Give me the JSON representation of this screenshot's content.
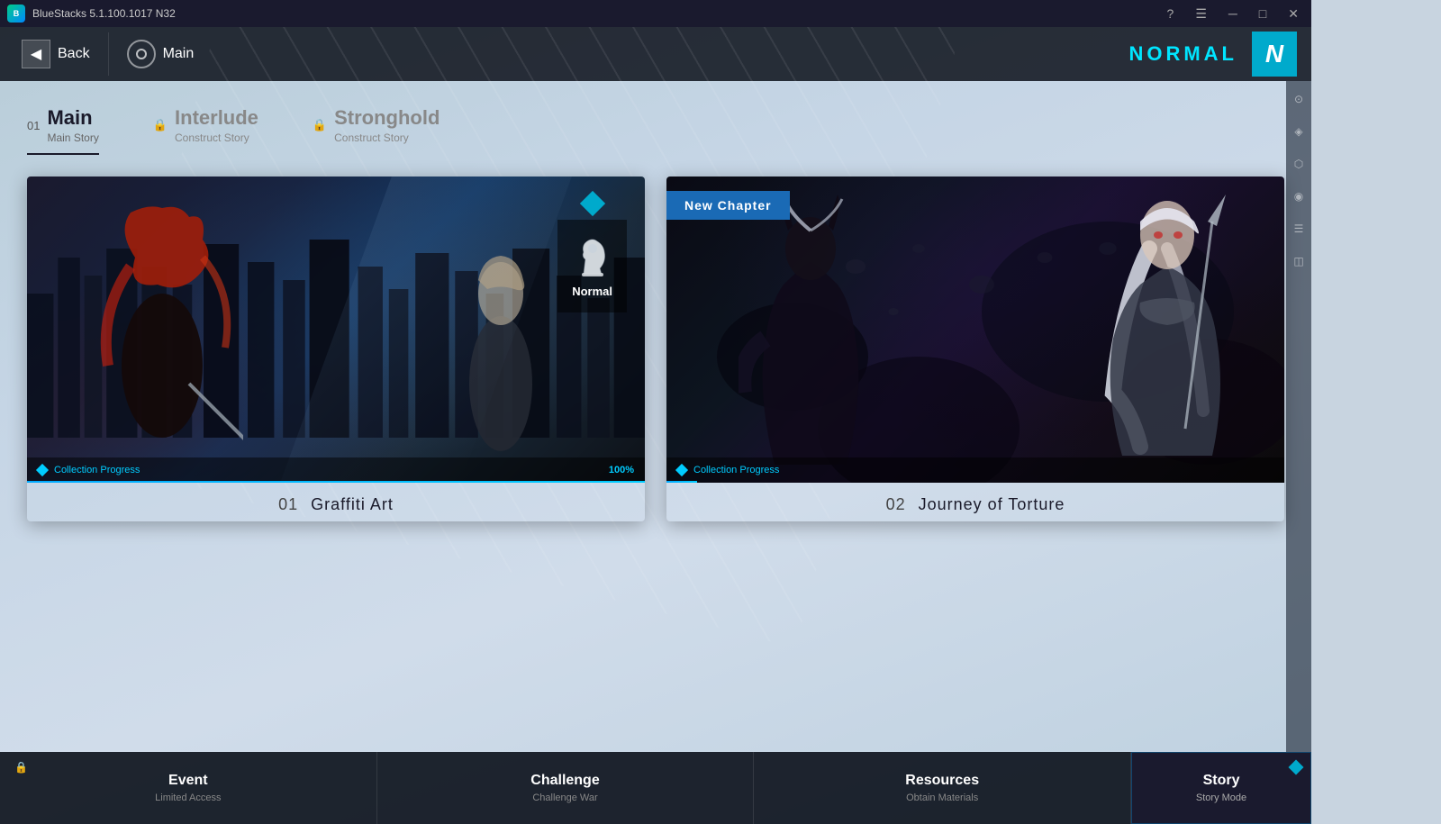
{
  "titlebar": {
    "logo_text": "B",
    "title": "BlueStacks 5.1.100.1017 N32",
    "controls": [
      "help",
      "menu",
      "minimize",
      "maximize",
      "close"
    ]
  },
  "topbar": {
    "back_label": "Back",
    "main_label": "Main",
    "normal_text": "NORMAL",
    "normal_icon": "N"
  },
  "tabs": [
    {
      "number": "01",
      "label": "Main",
      "sublabel": "Main Story",
      "active": true,
      "locked": false
    },
    {
      "number": "",
      "label": "Interlude",
      "sublabel": "Construct Story",
      "active": false,
      "locked": true
    },
    {
      "number": "",
      "label": "Stronghold",
      "sublabel": "Construct Story",
      "active": false,
      "locked": true
    }
  ],
  "cards": [
    {
      "number": "01",
      "title": "Graffiti Art",
      "chess_label": "Normal",
      "progress_label": "Collection Progress",
      "progress_percent": "100%",
      "new_chapter": false
    },
    {
      "number": "02",
      "title": "Journey of Torture",
      "chess_label": "",
      "progress_label": "Collection Progress",
      "progress_percent": "",
      "new_chapter": true,
      "new_chapter_label": "New Chapter"
    }
  ],
  "bottom_nav": [
    {
      "label": "Event",
      "sublabel": "Limited Access",
      "locked": true,
      "active": false
    },
    {
      "label": "Challenge",
      "sublabel": "Challenge War",
      "locked": false,
      "active": false
    },
    {
      "label": "Resources",
      "sublabel": "Obtain Materials",
      "locked": false,
      "active": false
    },
    {
      "label": "Story",
      "sublabel": "Story Mode",
      "active": true,
      "story": true
    }
  ],
  "sidebar_icons": [
    "⊙",
    "◈",
    "⬡",
    "◉",
    "☰",
    "◫"
  ]
}
